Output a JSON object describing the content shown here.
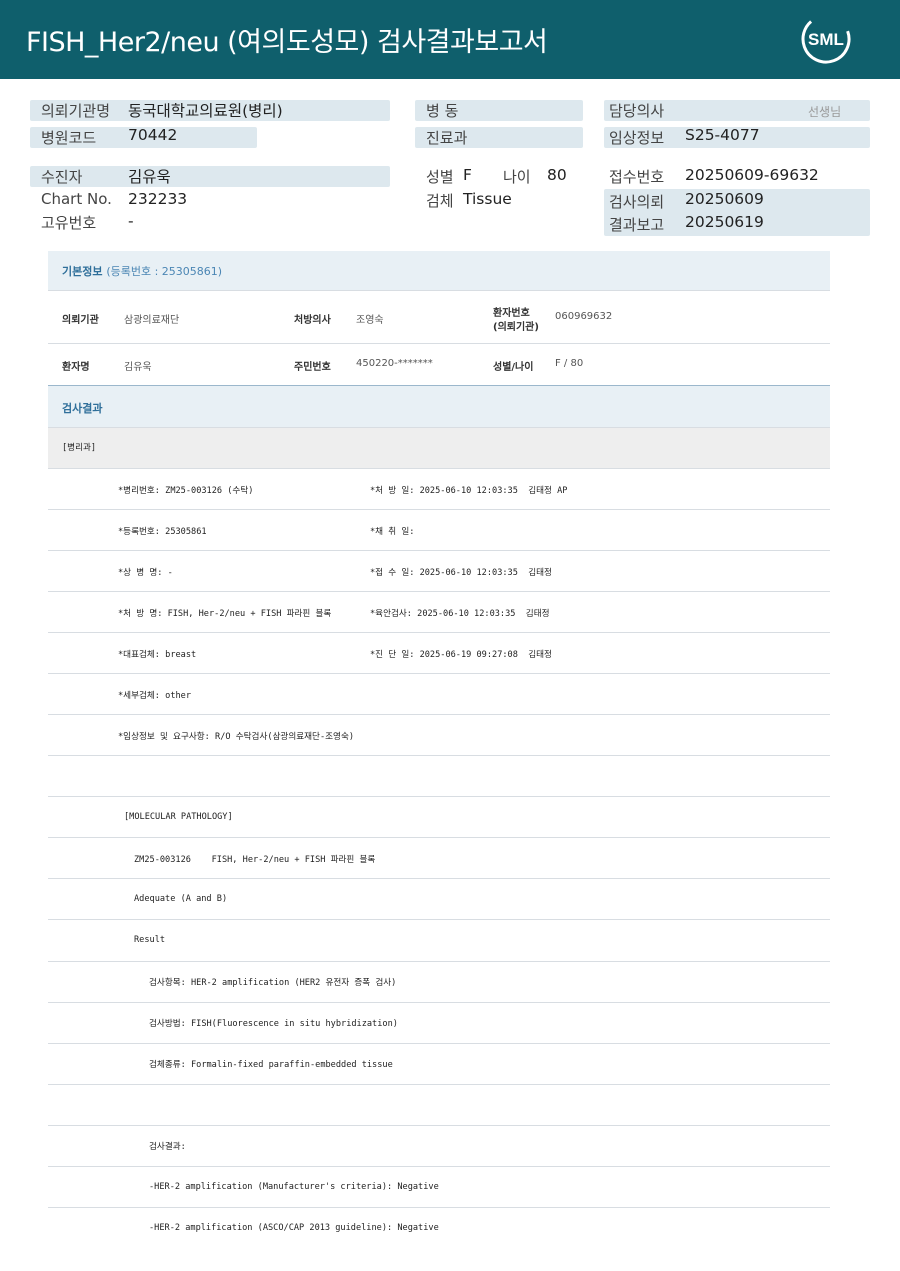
{
  "header": {
    "title": "FISH_Her2/neu  (여의도성모) 검사결과보고서",
    "logo_text": "SML",
    "bg_color": "#0f5f6c"
  },
  "info": {
    "req_org_label": "의뢰기관명",
    "req_org_value": "동국대학교의료원(병리)",
    "hosp_code_label": "병원코드",
    "hosp_code_value": "70442",
    "ward_label": "병  동",
    "dept_label": "진료과",
    "doctor_label": "담당의사",
    "doctor_suffix": "선생님",
    "clinical_label": "임상정보",
    "clinical_value": "S25-4077",
    "patient_label": "수진자",
    "patient_value": "김유욱",
    "chart_label": "Chart No.",
    "chart_value": "232233",
    "uid_label": "고유번호",
    "uid_value": "-",
    "sex_label": "성별",
    "sex_value": "F",
    "age_label": "나이",
    "age_value": "80",
    "specimen_label": "검체",
    "specimen_value": "Tissue",
    "accept_label": "접수번호",
    "accept_value": "20250609-69632",
    "request_label": "검사의뢰",
    "request_value": "20250609",
    "report_label": "결과보고",
    "report_value": "20250619"
  },
  "basic": {
    "title": "기본정보",
    "reg_note": "(등록번호 : 25305861)",
    "org_label": "의뢰기관",
    "org_value": "삼광의료재단",
    "presc_label": "처방의사",
    "presc_value": "조영숙",
    "ptno_label": "환자번호",
    "ptno_label2": "(의뢰기관)",
    "ptno_value": "060969632",
    "name_label": "환자명",
    "name_value": "김유욱",
    "rrn_label": "주민번호",
    "rrn_value": "450220-*******",
    "sexage_label": "성별/나이",
    "sexage_value": "F / 80"
  },
  "result": {
    "title": "검사결과",
    "dept_tag": "[병리과]",
    "left_lines": [
      "*병리번호: ZM25-003126 (수탁)",
      "*등록번호: 25305861",
      "*상 병 명: -",
      "*처 방 명: FISH, Her-2/neu + FISH 파라핀 블록",
      "*대표검체: breast",
      "*세부검체: other",
      "*임상정보 및 요구사항: R/O 수탁검사(삼광의료재단-조영숙)"
    ],
    "right_lines": [
      "*처 방 일: 2025-06-10 12:03:35  김태정 AP",
      "*채 취 일:",
      "*접 수 일: 2025-06-10 12:03:35  김태정",
      "*육안검사: 2025-06-10 12:03:35  김태정",
      "*진 단 일: 2025-06-19 09:27:08  김태정"
    ],
    "mp_header": "[MOLECULAR PATHOLOGY]",
    "mp_line1": "ZM25-003126    FISH, Her-2/neu + FISH 파라핀 블록",
    "mp_line2": "Adequate (A and B)",
    "mp_line3": "Result",
    "item_line": "검사항목: HER-2 amplification (HER2 유전자 증폭 검사)",
    "method_line": "검사방법: FISH(Fluorescence in situ hybridization)",
    "type_line": "검체종류: Formalin-fixed paraffin-embedded tissue",
    "outcome_header": "검사결과:",
    "outcome1": "-HER-2 amplification (Manufacturer's criteria): Negative",
    "outcome2": "-HER-2 amplification (ASCO/CAP 2013 guideline): Negative"
  }
}
